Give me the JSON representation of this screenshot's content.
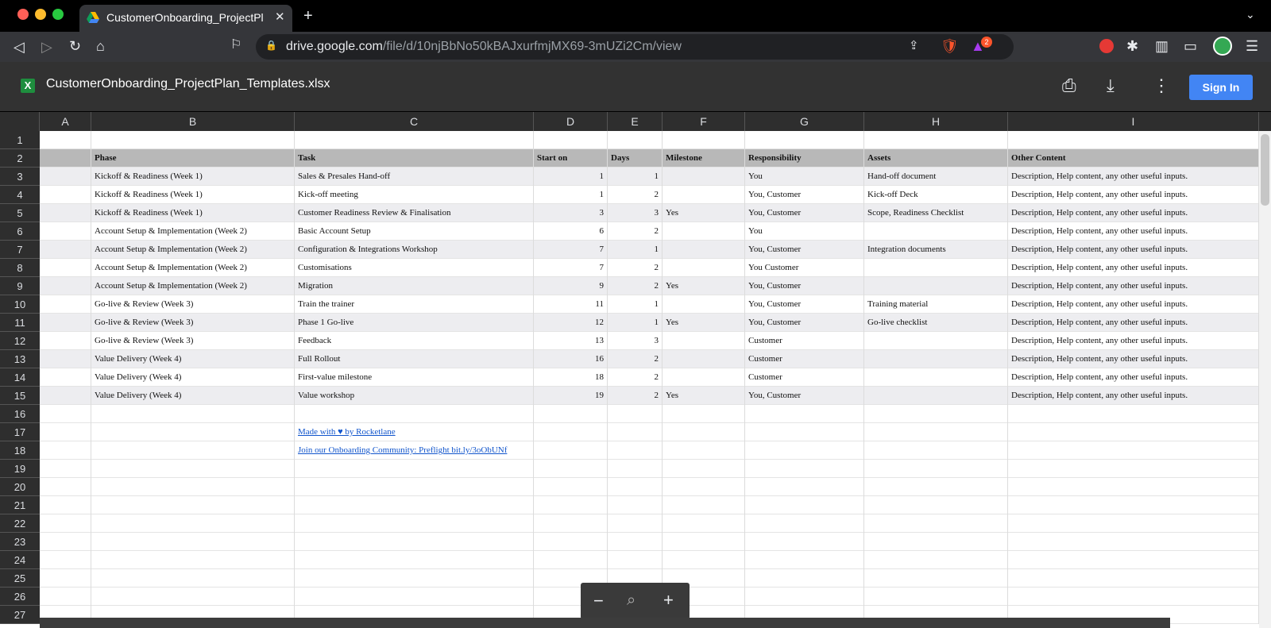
{
  "browser": {
    "tab_title": "CustomerOnboarding_ProjectPl",
    "url_domain": "drive.google.com",
    "url_path": "/file/d/10njBbNo50kBAJxurfmjMX69-3mUZi2Cm/view",
    "shield_badge": "2"
  },
  "drive": {
    "file_name": "CustomerOnboarding_ProjectPlan_Templates.xlsx",
    "sign_in": "Sign In",
    "file_icon_letter": "X"
  },
  "columns": [
    "A",
    "B",
    "C",
    "D",
    "E",
    "F",
    "G",
    "H",
    "I"
  ],
  "row_numbers": [
    "1",
    "2",
    "3",
    "4",
    "5",
    "6",
    "7",
    "8",
    "9",
    "10",
    "11",
    "12",
    "13",
    "14",
    "15",
    "16",
    "17",
    "18",
    "19",
    "20",
    "21",
    "22",
    "23",
    "24",
    "25",
    "26",
    "27"
  ],
  "headers": {
    "phase": "Phase",
    "task": "Task",
    "start": "Start on",
    "days": "Days",
    "milestone": "Milestone",
    "responsibility": "Responsibility",
    "assets": "Assets",
    "other": "Other Content"
  },
  "rows": [
    {
      "phase": "Kickoff & Readiness (Week 1)",
      "task": "Sales & Presales Hand-off",
      "start": "1",
      "days": "1",
      "milestone": "",
      "responsibility": "You",
      "assets": "Hand-off document",
      "other": "Description, Help content, any other useful inputs."
    },
    {
      "phase": "Kickoff & Readiness (Week 1)",
      "task": "Kick-off meeting",
      "start": "1",
      "days": "2",
      "milestone": "",
      "responsibility": "You, Customer",
      "assets": "Kick-off Deck",
      "other": "Description, Help content, any other useful inputs."
    },
    {
      "phase": "Kickoff & Readiness (Week 1)",
      "task": "Customer Readiness Review & Finalisation",
      "start": "3",
      "days": "3",
      "milestone": "Yes",
      "responsibility": "You, Customer",
      "assets": "Scope, Readiness Checklist",
      "other": "Description, Help content, any other useful inputs."
    },
    {
      "phase": "Account Setup & Implementation (Week 2)",
      "task": "Basic Account Setup",
      "start": "6",
      "days": "2",
      "milestone": "",
      "responsibility": "You",
      "assets": "",
      "other": "Description, Help content, any other useful inputs."
    },
    {
      "phase": "Account Setup & Implementation (Week 2)",
      "task": "Configuration & Integrations Workshop",
      "start": "7",
      "days": "1",
      "milestone": "",
      "responsibility": "You, Customer",
      "assets": "Integration documents",
      "other": "Description, Help content, any other useful inputs."
    },
    {
      "phase": "Account Setup & Implementation (Week 2)",
      "task": "Customisations",
      "start": "7",
      "days": "2",
      "milestone": "",
      "responsibility": "You Customer",
      "assets": "",
      "other": "Description, Help content, any other useful inputs."
    },
    {
      "phase": "Account Setup & Implementation (Week 2)",
      "task": "Migration",
      "start": "9",
      "days": "2",
      "milestone": "Yes",
      "responsibility": "You, Customer",
      "assets": "",
      "other": "Description, Help content, any other useful inputs."
    },
    {
      "phase": "Go-live & Review (Week 3)",
      "task": "Train the trainer",
      "start": "11",
      "days": "1",
      "milestone": "",
      "responsibility": "You, Customer",
      "assets": "Training material",
      "other": "Description, Help content, any other useful inputs."
    },
    {
      "phase": "Go-live & Review (Week 3)",
      "task": "Phase 1 Go-live",
      "start": "12",
      "days": "1",
      "milestone": "Yes",
      "responsibility": "You, Customer",
      "assets": "Go-live checklist",
      "other": "Description, Help content, any other useful inputs."
    },
    {
      "phase": "Go-live & Review (Week 3)",
      "task": "Feedback",
      "start": "13",
      "days": "3",
      "milestone": "",
      "responsibility": "Customer",
      "assets": "",
      "other": "Description, Help content, any other useful inputs."
    },
    {
      "phase": "Value Delivery (Week 4)",
      "task": "Full Rollout",
      "start": "16",
      "days": "2",
      "milestone": "",
      "responsibility": "Customer",
      "assets": "",
      "other": "Description, Help content, any other useful inputs."
    },
    {
      "phase": "Value Delivery (Week 4)",
      "task": "First-value milestone",
      "start": "18",
      "days": "2",
      "milestone": "",
      "responsibility": "Customer",
      "assets": "",
      "other": "Description, Help content, any other useful inputs."
    },
    {
      "phase": "Value Delivery (Week 4)",
      "task": "Value workshop",
      "start": "19",
      "days": "2",
      "milestone": "Yes",
      "responsibility": "You, Customer",
      "assets": "",
      "other": "Description, Help content, any other useful inputs."
    }
  ],
  "footer_links": [
    "Made with ♥ by Rocketlane",
    "Join our Onboarding Community:  Preflight bit.ly/3oObUNf"
  ],
  "colors": {
    "header_row": "#b8b8b8",
    "shaded_row": "#ededf0",
    "sign_in": "#4285f4",
    "link": "#1155cc"
  }
}
